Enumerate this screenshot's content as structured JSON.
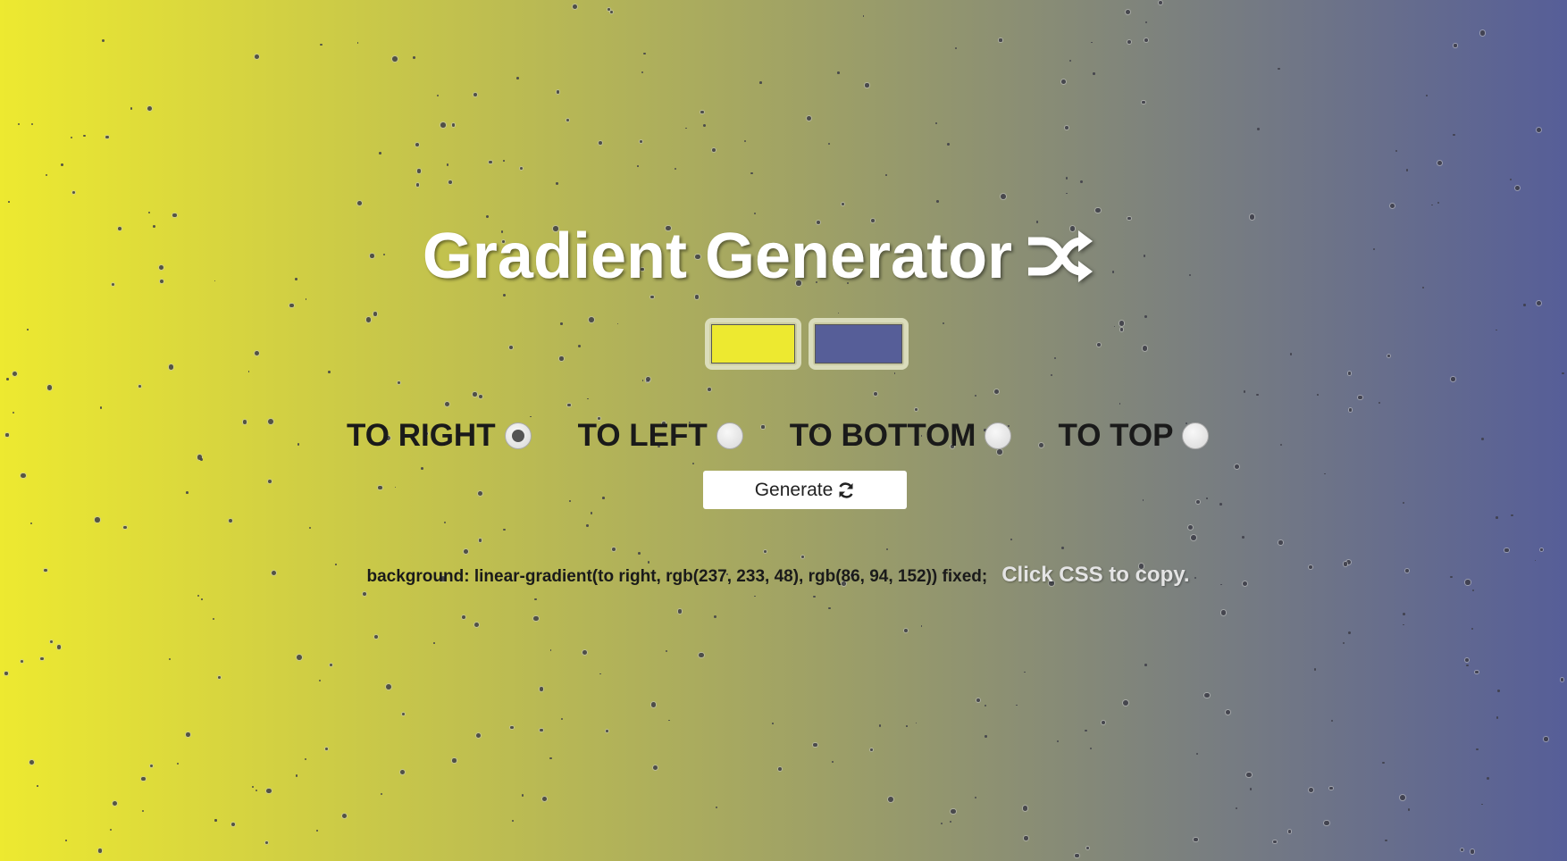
{
  "page": {
    "title": "Gradient Generator",
    "title_icon": "shuffle-icon"
  },
  "colors": {
    "start": "#ede930",
    "end": "#565e98",
    "css_text": "background: linear-gradient(to right, rgb(237, 233, 48), rgb(86, 94, 152)) fixed;"
  },
  "directions": [
    {
      "label": "TO RIGHT",
      "checked": true
    },
    {
      "label": "TO LEFT",
      "checked": false
    },
    {
      "label": "TO BOTTOM",
      "checked": false
    },
    {
      "label": "TO TOP",
      "checked": false
    }
  ],
  "generate": {
    "label": "Generate",
    "icon": "refresh-icon"
  },
  "copy_hint": "Click CSS to copy."
}
